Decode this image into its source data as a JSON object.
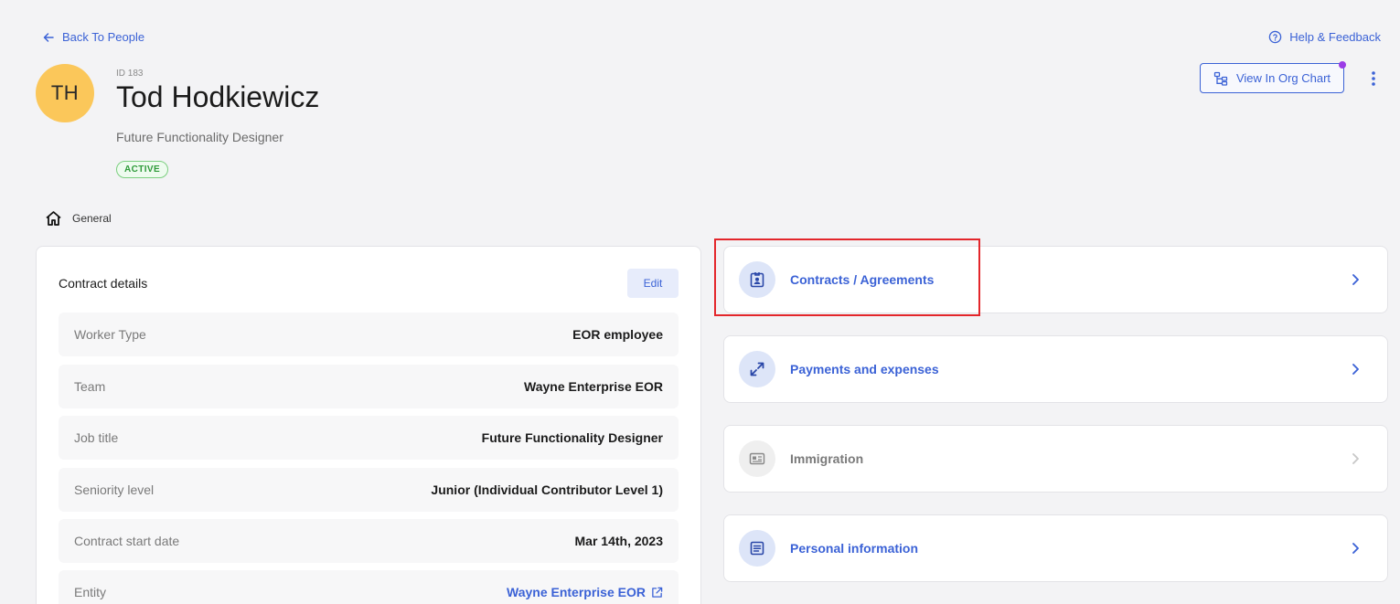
{
  "nav": {
    "back_label": "Back To People",
    "help_label": "Help & Feedback"
  },
  "profile": {
    "initials": "TH",
    "id_label": "ID 183",
    "name": "Tod Hodkiewicz",
    "job_title": "Future Functionality Designer",
    "status": "ACTIVE",
    "status_color": "#2f9a3a",
    "avatar_color": "#fbc75a"
  },
  "header_actions": {
    "org_chart_label": "View In Org Chart",
    "notification_dot_color": "#9b3ce6"
  },
  "breadcrumb": {
    "label": "General"
  },
  "contract_details": {
    "title": "Contract details",
    "edit_label": "Edit",
    "rows": [
      {
        "label": "Worker Type",
        "value": "EOR employee"
      },
      {
        "label": "Team",
        "value": "Wayne Enterprise EOR"
      },
      {
        "label": "Job title",
        "value": "Future Functionality Designer"
      },
      {
        "label": "Seniority level",
        "value": "Junior (Individual Contributor Level 1)"
      },
      {
        "label": "Contract start date",
        "value": "Mar 14th, 2023"
      },
      {
        "label": "Entity",
        "value": "Wayne Enterprise EOR"
      }
    ]
  },
  "sections": [
    {
      "label": "Contracts / Agreements",
      "icon": "contract-badge-icon",
      "enabled": true
    },
    {
      "label": "Payments and expenses",
      "icon": "arrows-expand-icon",
      "enabled": true
    },
    {
      "label": "Immigration",
      "icon": "id-card-icon",
      "enabled": false
    },
    {
      "label": "Personal information",
      "icon": "document-lines-icon",
      "enabled": true
    }
  ],
  "colors": {
    "accent": "#3b62d6",
    "background": "#f3f3f5",
    "highlight": "#e3262b"
  }
}
